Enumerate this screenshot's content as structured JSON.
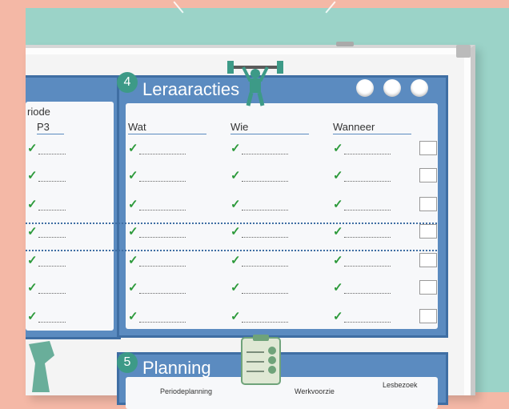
{
  "panel_left": {
    "subtitle": "riode",
    "column": "P3",
    "check": "✓"
  },
  "panel4": {
    "number": "4",
    "title": "Leraaracties",
    "columns": [
      "Wat",
      "Wie",
      "Wanneer"
    ],
    "check": "✓"
  },
  "panel5": {
    "number": "5",
    "title": "Planning",
    "col_a": "Periodeplanning",
    "col_b": "Werkvoorzie",
    "col_c": "Lesbezoek"
  },
  "icons": [
    "weightlifter-icon",
    "clipboard-checklist-icon",
    "figure-icon"
  ],
  "colors": {
    "panel": "#5b8bc0",
    "badge": "#3d9a87",
    "check": "#2d9a3b",
    "background": "#f4b8a6",
    "wall": "#9bd3c8"
  }
}
